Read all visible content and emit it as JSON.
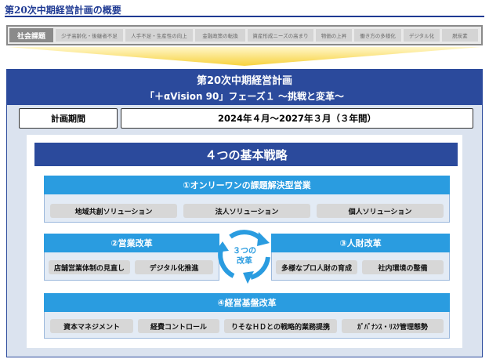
{
  "page_title": "第20次中期経営計画の概要",
  "social_issues": {
    "label": "社会課題",
    "items": [
      "少子高齢化・後継者不足",
      "人手不足・生産性の向上",
      "金融政策の転換",
      "資産形成ニーズの高まり",
      "物価の上昇",
      "働き方の多様化",
      "デジタル化",
      "脱炭素"
    ]
  },
  "plan": {
    "title": "第20次中期経営計画",
    "subtitle": "「＋αVision 90」フェーズ１ 〜挑戦と変革〜"
  },
  "period": {
    "label": "計画期間",
    "value": "2024年４月〜2027年３月（３年間）"
  },
  "strategies": {
    "title": "４つの基本戦略",
    "s1": {
      "title": "①オンリーワンの課題解決型営業",
      "items": [
        "地域共創ソリューション",
        "法人ソリューション",
        "個人ソリューション"
      ]
    },
    "s2": {
      "title": "②営業改革",
      "items": [
        "店舗営業体制の見直し",
        "デジタル化推進"
      ]
    },
    "s3": {
      "title": "③人財改革",
      "items": [
        "多様なプロ人財の育成",
        "社内環境の整備"
      ]
    },
    "s4": {
      "title": "④経営基盤改革",
      "items": [
        "資本マネジメント",
        "経費コントロール",
        "りそなＨＤとの戦略的業務提携",
        "ｶﾞﾊﾞﾅﾝｽ・ﾘｽｸ管理態勢"
      ]
    },
    "cycle_label_1": "３つの",
    "cycle_label_2": "改革"
  },
  "colors": {
    "navy": "#2b4a9c",
    "accent_blue": "#2a9ce0",
    "funnel_yellow": "#f7d23e",
    "panel_bg": "#dbe3ef"
  },
  "icons": {
    "cycle": "circular-arrows-icon",
    "funnel": "funnel-arrow-icon"
  }
}
